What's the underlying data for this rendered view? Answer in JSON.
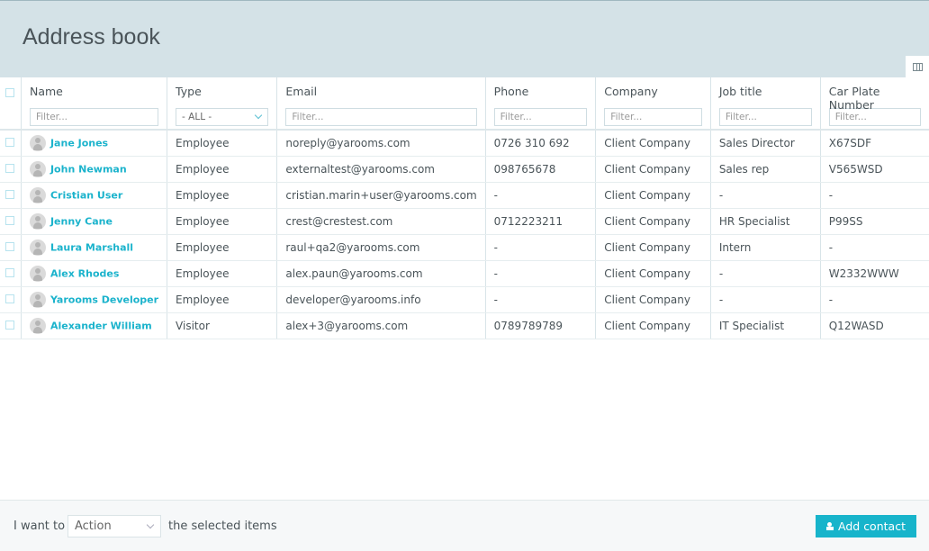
{
  "header": {
    "title": "Address book"
  },
  "columns": [
    "Name",
    "Type",
    "Email",
    "Phone",
    "Company",
    "Job title",
    "Car Plate Number"
  ],
  "filters": {
    "placeholder": "Filter...",
    "type_value": "- ALL -"
  },
  "rows": [
    [
      "Jane Jones",
      "Employee",
      "noreply@yarooms.com",
      "0726 310 692",
      "Client Company",
      "Sales Director",
      "X67SDF"
    ],
    [
      "John Newman",
      "Employee",
      "externaltest@yarooms.com",
      "098765678",
      "Client Company",
      "Sales rep",
      "V565WSD"
    ],
    [
      "Cristian User",
      "Employee",
      "cristian.marin+user@yarooms.com",
      "-",
      "Client Company",
      "-",
      "-"
    ],
    [
      "Jenny Cane",
      "Employee",
      "crest@crestest.com",
      "0712223211",
      "Client Company",
      "HR Specialist",
      "P99SS"
    ],
    [
      "Laura Marshall",
      "Employee",
      "raul+qa2@yarooms.com",
      "-",
      "Client Company",
      "Intern",
      "-"
    ],
    [
      "Alex Rhodes",
      "Employee",
      "alex.paun@yarooms.com",
      "-",
      "Client Company",
      "-",
      "W2332WWW"
    ],
    [
      "Yarooms Developer",
      "Employee",
      "developer@yarooms.info",
      "-",
      "Client Company",
      "-",
      "-"
    ],
    [
      "Alexander William",
      "Visitor",
      "alex+3@yarooms.com",
      "0789789789",
      "Client Company",
      "IT Specialist",
      "Q12WASD"
    ]
  ],
  "footer": {
    "prefix": "I want to",
    "action": "Action",
    "suffix": "the selected items",
    "add_label": "Add contact"
  },
  "colors": {
    "accent": "#17b4cb",
    "header_bg": "#d4e2e7"
  }
}
